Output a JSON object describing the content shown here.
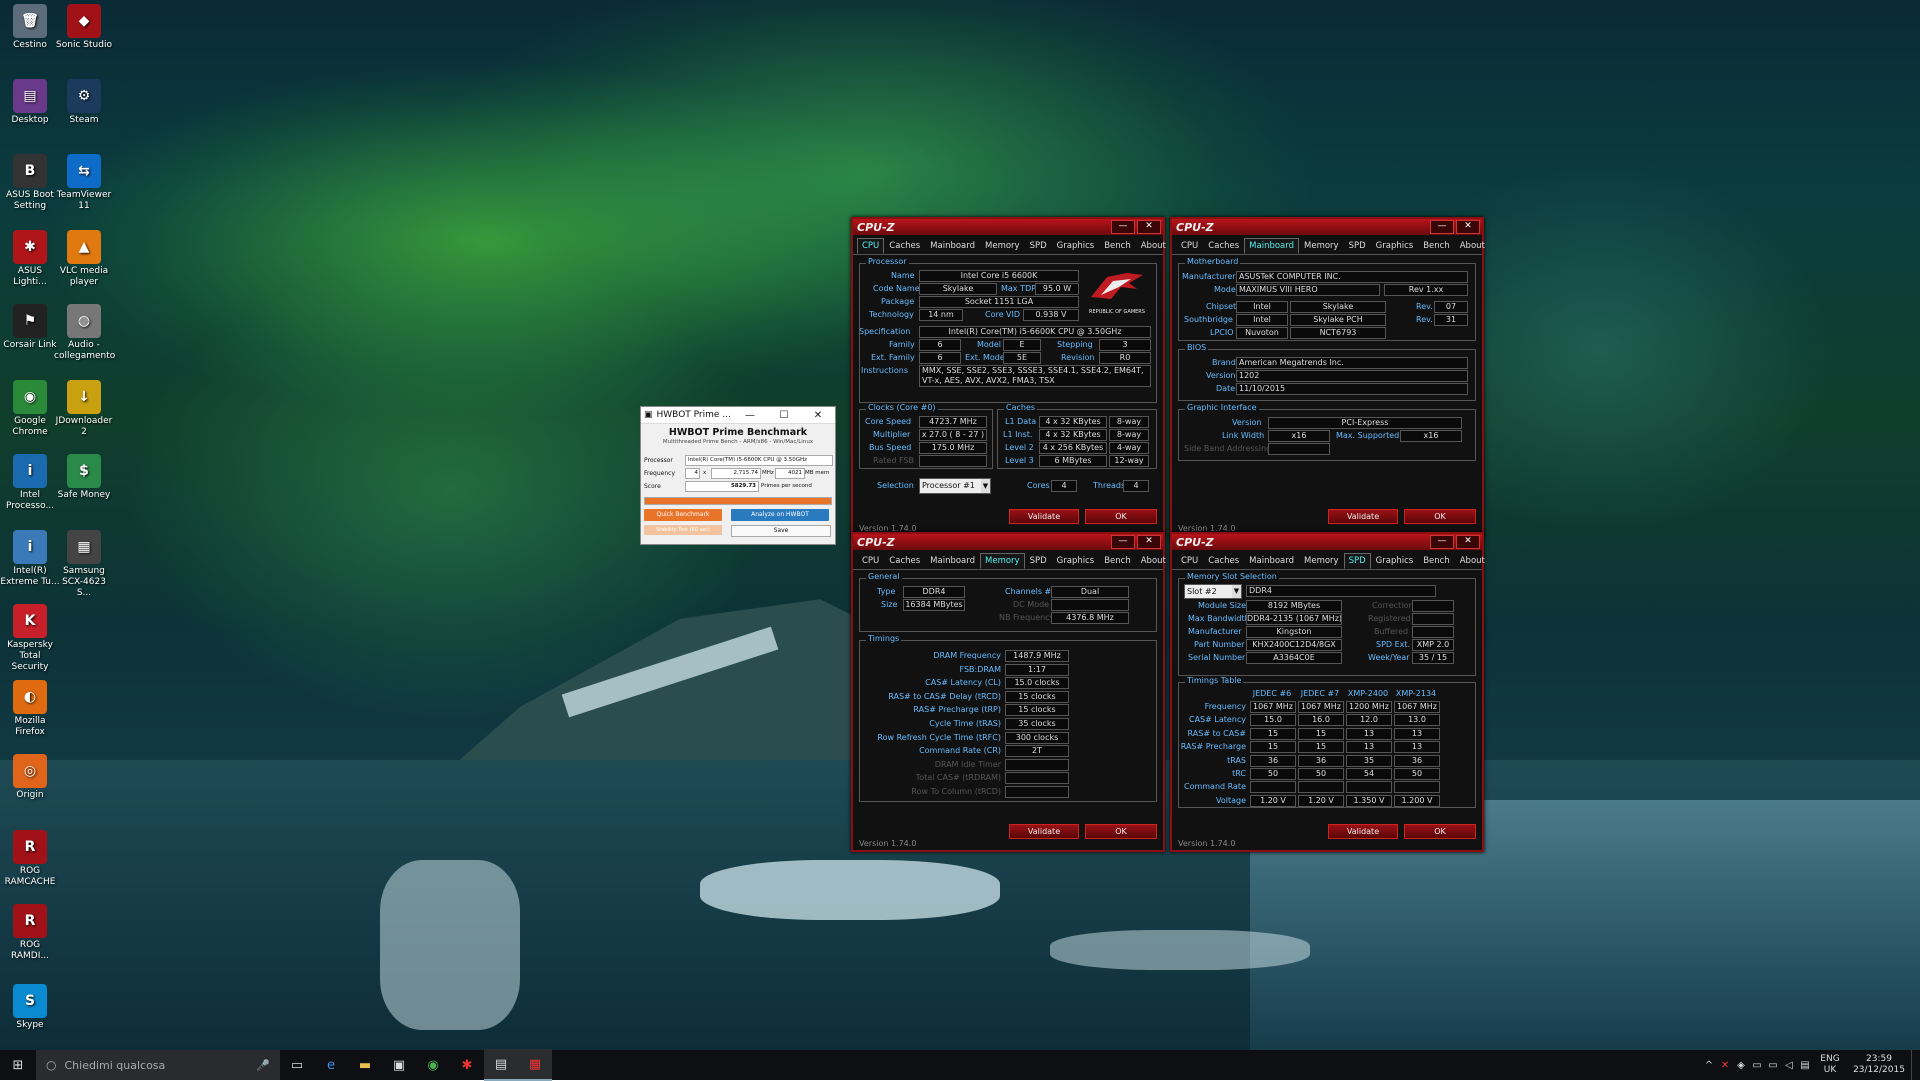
{
  "desktop_icons": [
    {
      "label": "Cestino",
      "icon": "recycle-bin-icon",
      "glyph": "🗑",
      "color": "#5c6c7a"
    },
    {
      "label": "Sonic Studio",
      "icon": "sonic-studio-icon",
      "glyph": "◆",
      "color": "#a01218"
    },
    {
      "label": "Desktop",
      "icon": "winrar-icon",
      "glyph": "▤",
      "color": "#6a3a8a"
    },
    {
      "label": "Steam",
      "icon": "steam-icon",
      "glyph": "⚙",
      "color": "#1b3a5c"
    },
    {
      "label": "ASUS Boot Setting",
      "icon": "bios-icon",
      "glyph": "B",
      "color": "#333"
    },
    {
      "label": "TeamViewer 11",
      "icon": "teamviewer-icon",
      "glyph": "⇆",
      "color": "#0e6cc8"
    },
    {
      "label": "ASUS Lighti...",
      "icon": "asus-lighting-icon",
      "glyph": "✱",
      "color": "#b0151a"
    },
    {
      "label": "VLC media player",
      "icon": "vlc-icon",
      "glyph": "▲",
      "color": "#e07a10"
    },
    {
      "label": "Corsair Link",
      "icon": "corsair-icon",
      "glyph": "⚑",
      "color": "#222"
    },
    {
      "label": "Audio - collegamento",
      "icon": "audio-icon",
      "glyph": "◍",
      "color": "#777"
    },
    {
      "label": "Google Chrome",
      "icon": "chrome-icon",
      "glyph": "◉",
      "color": "#2a8a3a"
    },
    {
      "label": "JDownloader 2",
      "icon": "jdownloader-icon",
      "glyph": "↓",
      "color": "#c8a010"
    },
    {
      "label": "Intel Processo...",
      "icon": "intel-icon",
      "glyph": "i",
      "color": "#1a6ab0"
    },
    {
      "label": "Safe Money",
      "icon": "safe-money-icon",
      "glyph": "$",
      "color": "#2a8a4a"
    },
    {
      "label": "Intel(R) Extreme Tu...",
      "icon": "intel-xtu-icon",
      "glyph": "i",
      "color": "#3a7ab8"
    },
    {
      "label": "Samsung SCX-4623 S...",
      "icon": "printer-icon",
      "glyph": "▦",
      "color": "#444"
    },
    {
      "label": "Kaspersky Total Security",
      "icon": "kaspersky-icon",
      "glyph": "K",
      "color": "#c8202a"
    },
    {
      "label": "Mozilla Firefox",
      "icon": "firefox-icon",
      "glyph": "◐",
      "color": "#e06a10"
    },
    {
      "label": "Origin",
      "icon": "origin-icon",
      "glyph": "◎",
      "color": "#e0641a"
    },
    {
      "label": "ROG RAMCACHE",
      "icon": "ramcache-icon",
      "glyph": "R",
      "color": "#a01218"
    },
    {
      "label": "ROG RAMDI...",
      "icon": "ramdisk-icon",
      "glyph": "R",
      "color": "#a01218"
    },
    {
      "label": "Skype",
      "icon": "skype-icon",
      "glyph": "S",
      "color": "#0a8ad0"
    }
  ],
  "cpuz_title": "CPU-Z",
  "tabs": [
    "CPU",
    "Caches",
    "Mainboard",
    "Memory",
    "SPD",
    "Graphics",
    "Bench",
    "About"
  ],
  "version": "Version 1.74.0",
  "btn_validate": "Validate",
  "btn_ok": "OK",
  "w1": {
    "grp_processor": "Processor",
    "l_name": "Name",
    "name": "Intel Core i5 6600K",
    "l_codename": "Code Name",
    "codename": "Skylake",
    "l_maxtdp": "Max TDP",
    "maxtdp": "95.0 W",
    "l_package": "Package",
    "package": "Socket 1151 LGA",
    "l_technology": "Technology",
    "technology": "14 nm",
    "l_corevid": "Core VID",
    "corevid": "0.938 V",
    "l_spec": "Specification",
    "spec": "Intel(R) Core(TM) i5-6600K CPU @ 3.50GHz",
    "l_family": "Family",
    "family": "6",
    "l_model": "Model",
    "model": "E",
    "l_stepping": "Stepping",
    "stepping": "3",
    "l_extfamily": "Ext. Family",
    "extfamily": "6",
    "l_extmodel": "Ext. Model",
    "extmodel": "5E",
    "l_revision": "Revision",
    "revision": "R0",
    "l_instructions": "Instructions",
    "instructions": "MMX, SSE, SSE2, SSE3, SSSE3, SSE4.1, SSE4.2, EM64T, VT-x, AES, AVX, AVX2, FMA3, TSX",
    "grp_clocks": "Clocks (Core #0)",
    "l_corespeed": "Core Speed",
    "corespeed": "4723.7 MHz",
    "l_multiplier": "Multiplier",
    "multiplier": "x 27.0 ( 8 - 27 )",
    "l_busspeed": "Bus Speed",
    "busspeed": "175.0 MHz",
    "l_ratedfsb": "Rated FSB",
    "grp_caches": "Caches",
    "l_l1d": "L1 Data",
    "l1d": "4 x 32 KBytes",
    "l1d_way": "8-way",
    "l_l1i": "L1 Inst.",
    "l1i": "4 x 32 KBytes",
    "l1i_way": "8-way",
    "l_l2": "Level 2",
    "l2": "4 x 256 KBytes",
    "l2_way": "4-way",
    "l_l3": "Level 3",
    "l3": "6 MBytes",
    "l3_way": "12-way",
    "l_selection": "Selection",
    "selection": "Processor #1",
    "l_cores": "Cores",
    "cores": "4",
    "l_threads": "Threads",
    "threads": "4",
    "rog_text": "REPUBLIC OF GAMERS"
  },
  "w2": {
    "grp_motherboard": "Motherboard",
    "l_manufacturer": "Manufacturer",
    "manufacturer": "ASUSTeK COMPUTER INC.",
    "l_model": "Model",
    "model": "MAXIMUS VIII HERO",
    "model_rev": "Rev 1.xx",
    "l_chipset": "Chipset",
    "chipset_v": "Intel",
    "chipset": "Skylake",
    "l_rev": "Rev.",
    "chipset_rev": "07",
    "l_southbridge": "Southbridge",
    "sb_v": "Intel",
    "sb": "Skylake PCH",
    "sb_rev": "31",
    "l_lpcio": "LPCIO",
    "lpcio_v": "Nuvoton",
    "lpcio": "NCT6793",
    "grp_bios": "BIOS",
    "l_brand": "Brand",
    "brand": "American Megatrends Inc.",
    "l_version": "Version",
    "bios_version": "1202",
    "l_date": "Date",
    "bios_date": "11/10/2015",
    "grp_graphic": "Graphic Interface",
    "l_gversion": "Version",
    "gversion": "PCI-Express",
    "l_linkwidth": "Link Width",
    "linkwidth": "x16",
    "l_maxsupported": "Max. Supported",
    "maxsupported": "x16",
    "l_sideband": "Side Band Addressing"
  },
  "w3": {
    "grp_general": "General",
    "l_type": "Type",
    "type": "DDR4",
    "l_channels": "Channels #",
    "channels": "Dual",
    "l_size": "Size",
    "size": "16384 MBytes",
    "l_dcmode": "DC Mode",
    "l_nbfreq": "NB Frequency",
    "nbfreq": "4376.8 MHz",
    "grp_timings": "Timings",
    "timings": [
      {
        "label": "DRAM Frequency",
        "value": "1487.9 MHz",
        "dim": false
      },
      {
        "label": "FSB:DRAM",
        "value": "1:17",
        "dim": false
      },
      {
        "label": "CAS# Latency (CL)",
        "value": "15.0 clocks",
        "dim": false
      },
      {
        "label": "RAS# to CAS# Delay (tRCD)",
        "value": "15 clocks",
        "dim": false
      },
      {
        "label": "RAS# Precharge (tRP)",
        "value": "15 clocks",
        "dim": false
      },
      {
        "label": "Cycle Time (tRAS)",
        "value": "35 clocks",
        "dim": false
      },
      {
        "label": "Row Refresh Cycle Time (tRFC)",
        "value": "300 clocks",
        "dim": false
      },
      {
        "label": "Command Rate (CR)",
        "value": "2T",
        "dim": false
      },
      {
        "label": "DRAM Idle Timer",
        "value": "",
        "dim": true
      },
      {
        "label": "Total CAS# (tRDRAM)",
        "value": "",
        "dim": true
      },
      {
        "label": "Row To Column (tRCD)",
        "value": "",
        "dim": true
      }
    ]
  },
  "w4": {
    "grp_slot": "Memory Slot Selection",
    "slot": "Slot #2",
    "slot_type": "DDR4",
    "l_modulesize": "Module Size",
    "modulesize": "8192 MBytes",
    "l_correction": "Correction",
    "l_maxbw": "Max Bandwidth",
    "maxbw": "DDR4-2135 (1067 MHz)",
    "l_registered": "Registered",
    "l_manufacturer": "Manufacturer",
    "manufacturer": "Kingston",
    "l_buffered": "Buffered",
    "l_partnumber": "Part Number",
    "partnumber": "KHX2400C12D4/8GX",
    "l_spdext": "SPD Ext.",
    "spdext": "XMP 2.0",
    "l_serial": "Serial Number",
    "serial": "A3364C0E",
    "l_weekyear": "Week/Year",
    "weekyear": "35 / 15",
    "grp_timings": "Timings Table",
    "cols": [
      "JEDEC #6",
      "JEDEC #7",
      "XMP-2400",
      "XMP-2134"
    ],
    "rows": [
      {
        "label": "Frequency",
        "values": [
          "1067 MHz",
          "1067 MHz",
          "1200 MHz",
          "1067 MHz"
        ]
      },
      {
        "label": "CAS# Latency",
        "values": [
          "15.0",
          "16.0",
          "12.0",
          "13.0"
        ]
      },
      {
        "label": "RAS# to CAS#",
        "values": [
          "15",
          "15",
          "13",
          "13"
        ]
      },
      {
        "label": "RAS# Precharge",
        "values": [
          "15",
          "15",
          "13",
          "13"
        ]
      },
      {
        "label": "tRAS",
        "values": [
          "36",
          "36",
          "35",
          "36"
        ]
      },
      {
        "label": "tRC",
        "values": [
          "50",
          "50",
          "54",
          "50"
        ]
      },
      {
        "label": "Command Rate",
        "values": [
          "",
          "",
          "",
          ""
        ]
      },
      {
        "label": "Voltage",
        "values": [
          "1.20 V",
          "1.20 V",
          "1.350 V",
          "1.200 V"
        ]
      }
    ]
  },
  "hwbot": {
    "title": "HWBOT Prime ...",
    "heading": "HWBOT Prime Benchmark",
    "subtitle": "Multithreaded Prime Bench - ARM/x86 - Win/Mac/Linux",
    "l_processor": "Processor",
    "processor": "Intel(R) Core(TM) i5-6600K CPU @ 3.50GHz",
    "l_frequency": "Frequency",
    "freq_cores": "4",
    "freq_x": "x",
    "freq_mhz_val": "2,715.74",
    "freq_mhz": "MHz",
    "mem_val": "4021",
    "mem_unit": "MB mem",
    "l_score": "Score",
    "score": "5829.73",
    "score_unit": "Primes per second",
    "quick": "Quick Benchmark",
    "analyze": "Analyze on HWBOT",
    "stability": "Stability Test (60 sec)",
    "save": "Save",
    "progress": 1.0
  },
  "taskbar": {
    "search_placeholder": "Chiedimi qualcosa",
    "lang": "ENG",
    "region": "UK",
    "time": "23:59",
    "date": "23/12/2015"
  }
}
